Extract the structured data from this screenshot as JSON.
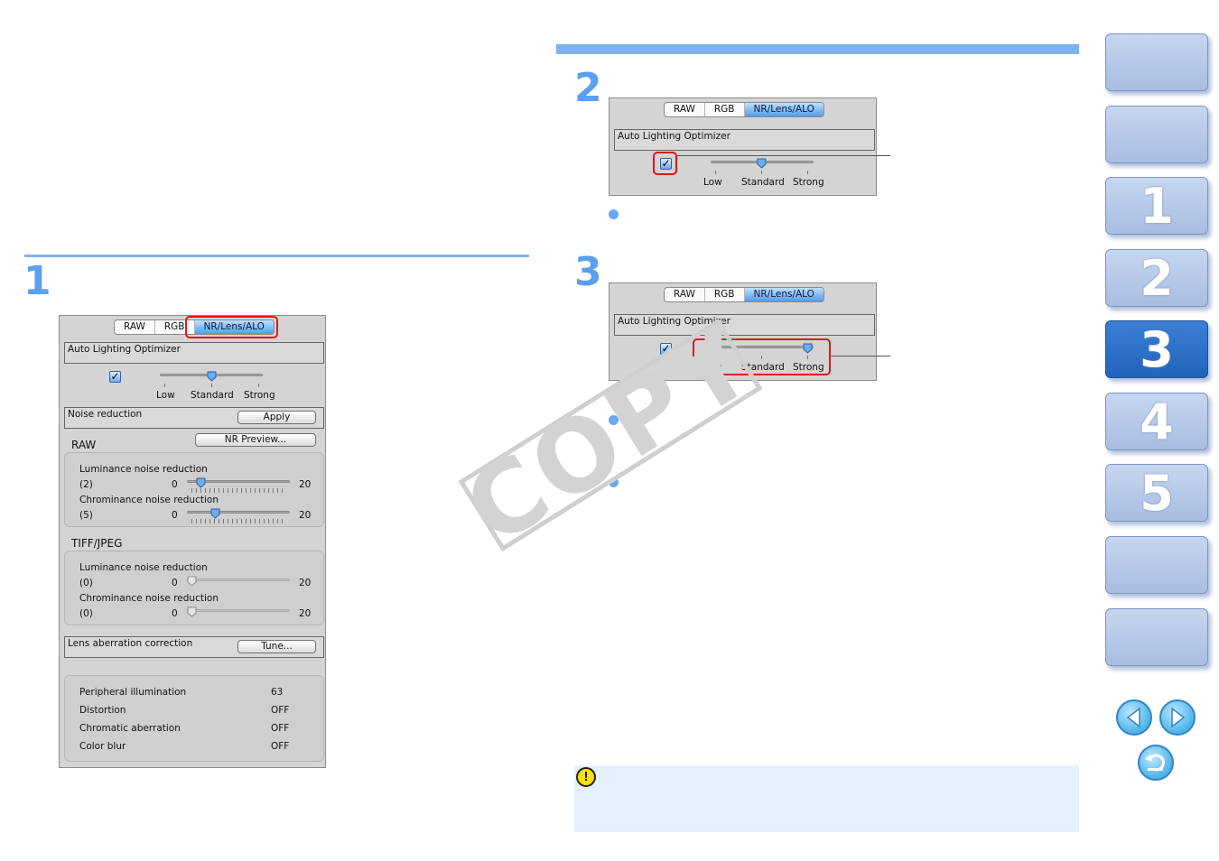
{
  "panel_tabs": [
    "RAW",
    "RGB",
    "NR/Lens/ALO"
  ],
  "alo": {
    "title": "Auto Lighting Optimizer",
    "checked_mark": "✓",
    "labels": [
      "Low",
      "Standard",
      "Strong"
    ],
    "level_step2": "Standard",
    "level_step3": "Strong"
  },
  "steps": {
    "step1": "1",
    "step2": "2",
    "step3": "3"
  },
  "main_panel": {
    "noise_reduction_label": "Noise reduction",
    "apply_label": "Apply",
    "raw_label": "RAW",
    "nr_preview_label": "NR Preview...",
    "raw_lum_label": "Luminance noise reduction",
    "raw_lum_value": "(2)",
    "raw_chrom_label": "Chrominance noise reduction",
    "raw_chrom_value": "(5)",
    "slider_min": "0",
    "slider_max": "20",
    "raw_lum_level": 2,
    "raw_chrom_level": 5,
    "tiff_label": "TIFF/JPEG",
    "tiff_lum_label": "Luminance noise reduction",
    "tiff_lum_value": "(0)",
    "tiff_chrom_label": "Chrominance noise reduction",
    "tiff_chrom_value": "(0)",
    "lens_label": "Lens aberration correction",
    "tune_label": "Tune...",
    "aberration_rows": [
      {
        "name": "Peripheral illumination",
        "value": "63"
      },
      {
        "name": "Distortion",
        "value": "OFF"
      },
      {
        "name": "Chromatic aberration",
        "value": "OFF"
      },
      {
        "name": "Color blur",
        "value": "OFF"
      }
    ]
  },
  "watermark": "COPY",
  "caution_mark": "!",
  "side_nav": {
    "chapters": [
      "",
      "",
      "1",
      "2",
      "3",
      "4",
      "5",
      "",
      ""
    ],
    "active_chapter": "3"
  },
  "colors": {
    "accent": "#7fb2f0",
    "step_number": "#5aa0ee",
    "highlight": "#e0161b",
    "nav_active": "#2264bd",
    "caution_bg": "#e5f1fc"
  }
}
